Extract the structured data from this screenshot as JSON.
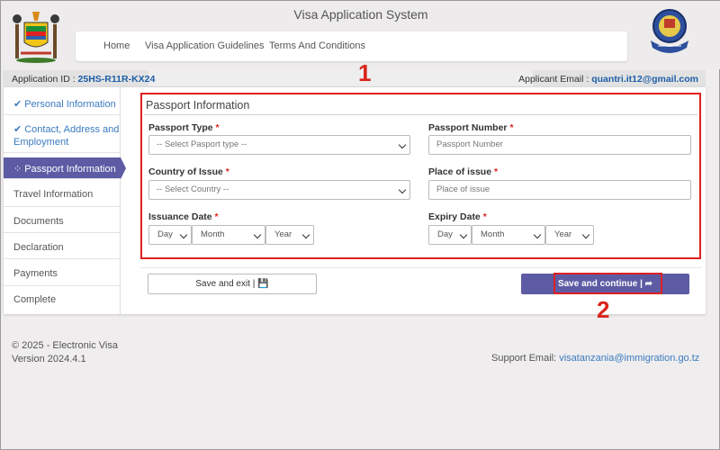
{
  "header": {
    "title": "Visa Application System",
    "nav": [
      "Home",
      "Visa Application Guidelines",
      "Terms And Conditions"
    ]
  },
  "infobar": {
    "app_id_label": "Application ID :",
    "app_id": "25HS-R11R-KX24",
    "email_label": "Applicant Email :",
    "email": "quantri.it12@gmail.com"
  },
  "sidebar": {
    "items": [
      {
        "label": "Personal Information",
        "status": "done"
      },
      {
        "label": "Contact, Address and Employment",
        "status": "done"
      },
      {
        "label": "Passport Information",
        "status": "active"
      },
      {
        "label": "Travel Information",
        "status": ""
      },
      {
        "label": "Documents",
        "status": ""
      },
      {
        "label": "Declaration",
        "status": ""
      },
      {
        "label": "Payments",
        "status": ""
      },
      {
        "label": "Complete",
        "status": ""
      }
    ]
  },
  "form": {
    "title": "Passport Information",
    "passport_type": {
      "label": "Passport Type",
      "value": "-- Select Pasport type --"
    },
    "passport_number": {
      "label": "Passport Number",
      "placeholder": "Passport Number"
    },
    "country_of_issue": {
      "label": "Country of Issue",
      "value": "-- Select Country --"
    },
    "place_of_issue": {
      "label": "Place of issue",
      "placeholder": "Place of issue"
    },
    "issuance_date": {
      "label": "Issuance Date",
      "day": "Day",
      "month": "Month",
      "year": "Year"
    },
    "expiry_date": {
      "label": "Expiry Date",
      "day": "Day",
      "month": "Month",
      "year": "Year"
    },
    "required_mark": "*"
  },
  "buttons": {
    "save_exit": "Save and exit |",
    "save_continue": "Save and continue |"
  },
  "annotations": {
    "one": "1",
    "two": "2"
  },
  "footer": {
    "copyright": "© 2025 - Electronic Visa",
    "version": "Version 2024.4.1",
    "support_label": "Support Email:",
    "support_email": "visatanzania@immigration.go.tz"
  },
  "colors": {
    "accent": "#5c5ba4",
    "highlight": "#e02020",
    "link": "#3a7bbf"
  }
}
